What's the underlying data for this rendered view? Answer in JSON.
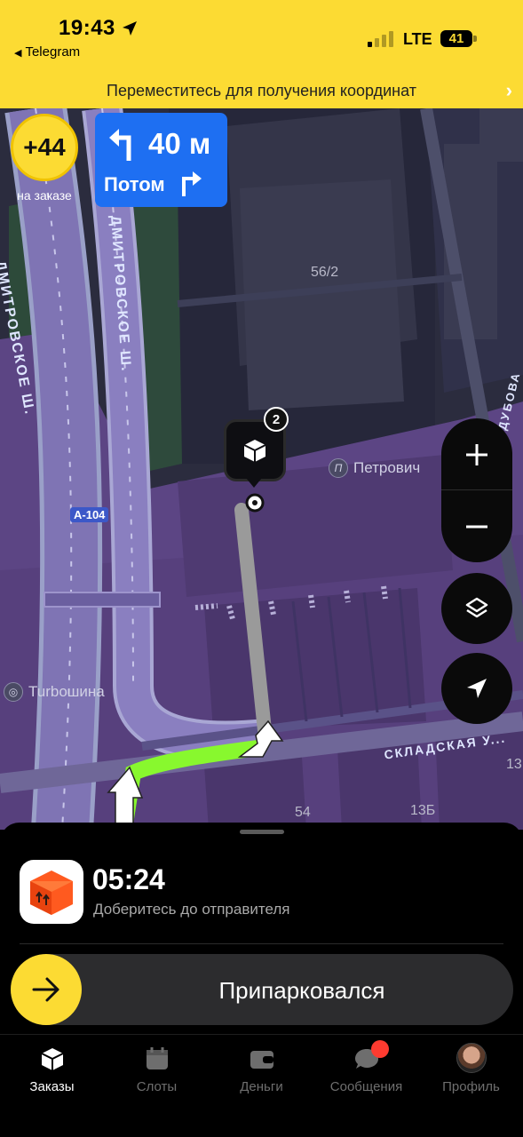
{
  "status_bar": {
    "time": "19:43",
    "back_app": "Telegram",
    "network": "LTE",
    "battery": "41"
  },
  "banner": {
    "text": "Переместитесь для получения координат"
  },
  "map": {
    "bonus_badge": {
      "value": "+44",
      "label": "на заказе"
    },
    "navigation": {
      "distance": "40 м",
      "then_label": "Потом",
      "turn_icon": "turn-left-icon",
      "next_turn_icon": "turn-right-icon"
    },
    "labels": {
      "building": "56/2",
      "road_1": "ДМИТРОВСКОЕ Ш.",
      "road_2": "ДМИТРОВСКОЕ Ш.",
      "road_3": "СКЛАДСКАЯ У...",
      "road_4": "ДУБОВА",
      "highway": "А-104",
      "house_54": "54",
      "house_13b": "13Б",
      "house_13": "13"
    },
    "pois": {
      "petrovich": {
        "name": "Петрович",
        "icon": "П"
      },
      "turboshina": {
        "name": "Turboшина"
      }
    },
    "pickup_pin": {
      "count": "2",
      "icon": "parcel-box-icon"
    },
    "controls": [
      "zoom-in-icon",
      "zoom-out-icon",
      "layers-icon",
      "locate-icon"
    ],
    "colors": {
      "map_bg": "#2b2c3e",
      "zone": "#5c4584",
      "route_done": "#9a9a9a",
      "route_active": "#88f82e"
    }
  },
  "sheet": {
    "eta": "05:24",
    "subtitle": "Доберитесь до отправителя",
    "action_label": "Припарковался",
    "action_icon": "arrow-right-icon"
  },
  "tabs": [
    {
      "label": "Заказы",
      "icon": "orders-icon",
      "active": true
    },
    {
      "label": "Слоты",
      "icon": "calendar-icon",
      "active": false
    },
    {
      "label": "Деньги",
      "icon": "wallet-icon",
      "active": false
    },
    {
      "label": "Сообщения",
      "icon": "chat-icon",
      "active": false,
      "notification": true
    },
    {
      "label": "Профиль",
      "icon": "avatar",
      "active": false
    }
  ],
  "accent_color": "#fcdb33"
}
